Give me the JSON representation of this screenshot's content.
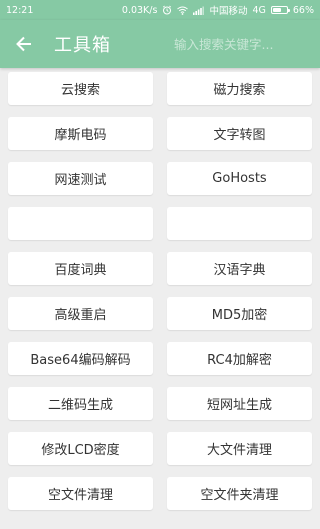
{
  "status_bar": {
    "time": "12:21",
    "speed": "0.03K/s",
    "carrier": "中国移动",
    "network": "4G",
    "battery": "66%",
    "battery_level": 0.66
  },
  "toolbar": {
    "back_icon": "arrow-left-icon",
    "title": "工具箱",
    "search_placeholder": "输入搜索关键字...",
    "background": "#86c9a4"
  },
  "tools": [
    {
      "label": "云搜索"
    },
    {
      "label": "磁力搜索"
    },
    {
      "label": "摩斯电码"
    },
    {
      "label": "文字转图"
    },
    {
      "label": "网速测试"
    },
    {
      "label": "GoHosts"
    },
    {
      "label": ""
    },
    {
      "label": ""
    },
    {
      "label": "百度词典"
    },
    {
      "label": "汉语字典"
    },
    {
      "label": "高级重启"
    },
    {
      "label": "MD5加密"
    },
    {
      "label": "Base64编码解码"
    },
    {
      "label": "RC4加解密"
    },
    {
      "label": "二维码生成"
    },
    {
      "label": "短网址生成"
    },
    {
      "label": "修改LCD密度"
    },
    {
      "label": "大文件清理"
    },
    {
      "label": "空文件清理"
    },
    {
      "label": "空文件夹清理"
    }
  ]
}
